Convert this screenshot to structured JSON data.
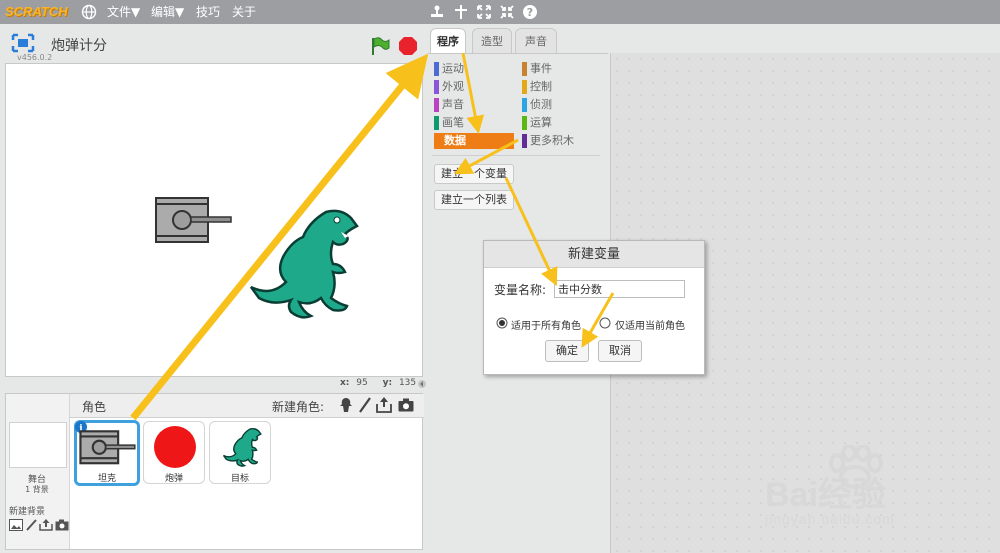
{
  "menubar": {
    "logo": "SCRATCH",
    "file": "文件▼",
    "edit": "编辑▼",
    "tips": "技巧",
    "about": "关于",
    "icons": [
      "globe-icon",
      "stamp-icon",
      "cut-icon",
      "grow-icon",
      "shrink-icon",
      "help-icon"
    ]
  },
  "stage": {
    "project_title": "炮弹计分",
    "version": "v456.0.2",
    "coords_x_label": "x:",
    "coords_x": "95",
    "coords_y_label": "y:",
    "coords_y": "135"
  },
  "sprites": {
    "header_label": "角色",
    "new_sprite_label": "新建角色:",
    "stage_label": "舞台",
    "stage_backdrops": "1 背景",
    "new_backdrop_label": "新建背景",
    "items": [
      {
        "name": "坦克",
        "selected": true
      },
      {
        "name": "炮弹",
        "selected": false
      },
      {
        "name": "目标",
        "selected": false
      }
    ]
  },
  "tabs": [
    "程序",
    "造型",
    "声音"
  ],
  "categories": {
    "left": [
      {
        "label": "运动",
        "color": "#4a6cd4"
      },
      {
        "label": "外观",
        "color": "#8a55d7"
      },
      {
        "label": "声音",
        "color": "#bb42c3"
      },
      {
        "label": "画笔",
        "color": "#0e9a6c"
      },
      {
        "label": "数据",
        "color": "#ee7d16"
      }
    ],
    "right": [
      {
        "label": "事件",
        "color": "#c88330"
      },
      {
        "label": "控制",
        "color": "#e1a91a"
      },
      {
        "label": "侦测",
        "color": "#2ca5e2"
      },
      {
        "label": "运算",
        "color": "#5cb712"
      },
      {
        "label": "更多积木",
        "color": "#632d99"
      }
    ],
    "selected": "数据"
  },
  "palette_buttons": {
    "make_variable": "建立一个变量",
    "make_list": "建立一个列表"
  },
  "dialog": {
    "title": "新建变量",
    "name_label": "变量名称:",
    "name_value": "击中分数",
    "option_all": "适用于所有角色",
    "option_this": "仅适用当前角色",
    "selected_option": "适用于所有角色",
    "ok": "确定",
    "cancel": "取消"
  },
  "watermark": {
    "brand": "Bai经验",
    "url": "jingyan.baidu.com"
  },
  "colors": {
    "menubar": "#9c9ea2",
    "annotation_arrow": "#f8c01b",
    "selected_sprite_border": "#3fa0de",
    "data_category": "#ee7d16"
  }
}
